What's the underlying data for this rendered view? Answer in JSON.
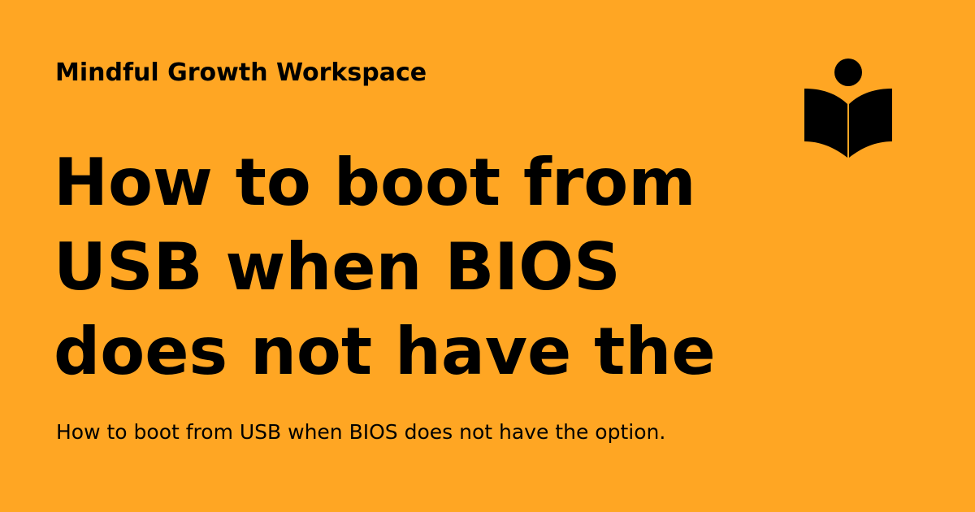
{
  "site": {
    "name": "Mindful Growth Workspace"
  },
  "headline": {
    "lines": [
      "How to boot from",
      "USB when BIOS",
      "does not have the"
    ]
  },
  "description": "How to boot from USB when BIOS does not have the option.",
  "logo": {
    "icon": "reader-book-icon"
  },
  "colors": {
    "background": "#FFA623",
    "text": "#000000"
  }
}
